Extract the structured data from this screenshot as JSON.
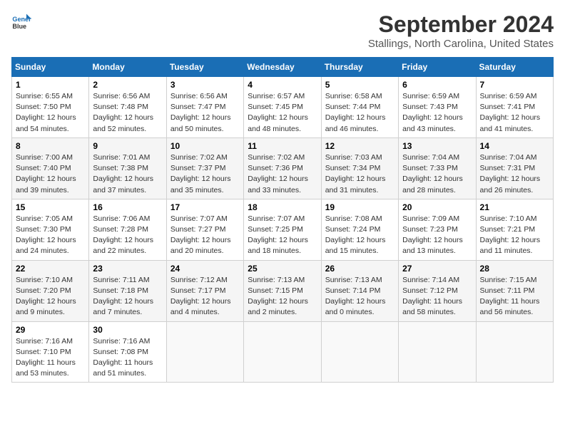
{
  "header": {
    "logo_line1": "General",
    "logo_line2": "Blue",
    "month": "September 2024",
    "location": "Stallings, North Carolina, United States"
  },
  "weekdays": [
    "Sunday",
    "Monday",
    "Tuesday",
    "Wednesday",
    "Thursday",
    "Friday",
    "Saturday"
  ],
  "weeks": [
    [
      {
        "day": "1",
        "sunrise": "6:55 AM",
        "sunset": "7:50 PM",
        "daylight": "12 hours and 54 minutes."
      },
      {
        "day": "2",
        "sunrise": "6:56 AM",
        "sunset": "7:48 PM",
        "daylight": "12 hours and 52 minutes."
      },
      {
        "day": "3",
        "sunrise": "6:56 AM",
        "sunset": "7:47 PM",
        "daylight": "12 hours and 50 minutes."
      },
      {
        "day": "4",
        "sunrise": "6:57 AM",
        "sunset": "7:45 PM",
        "daylight": "12 hours and 48 minutes."
      },
      {
        "day": "5",
        "sunrise": "6:58 AM",
        "sunset": "7:44 PM",
        "daylight": "12 hours and 46 minutes."
      },
      {
        "day": "6",
        "sunrise": "6:59 AM",
        "sunset": "7:43 PM",
        "daylight": "12 hours and 43 minutes."
      },
      {
        "day": "7",
        "sunrise": "6:59 AM",
        "sunset": "7:41 PM",
        "daylight": "12 hours and 41 minutes."
      }
    ],
    [
      {
        "day": "8",
        "sunrise": "7:00 AM",
        "sunset": "7:40 PM",
        "daylight": "12 hours and 39 minutes."
      },
      {
        "day": "9",
        "sunrise": "7:01 AM",
        "sunset": "7:38 PM",
        "daylight": "12 hours and 37 minutes."
      },
      {
        "day": "10",
        "sunrise": "7:02 AM",
        "sunset": "7:37 PM",
        "daylight": "12 hours and 35 minutes."
      },
      {
        "day": "11",
        "sunrise": "7:02 AM",
        "sunset": "7:36 PM",
        "daylight": "12 hours and 33 minutes."
      },
      {
        "day": "12",
        "sunrise": "7:03 AM",
        "sunset": "7:34 PM",
        "daylight": "12 hours and 31 minutes."
      },
      {
        "day": "13",
        "sunrise": "7:04 AM",
        "sunset": "7:33 PM",
        "daylight": "12 hours and 28 minutes."
      },
      {
        "day": "14",
        "sunrise": "7:04 AM",
        "sunset": "7:31 PM",
        "daylight": "12 hours and 26 minutes."
      }
    ],
    [
      {
        "day": "15",
        "sunrise": "7:05 AM",
        "sunset": "7:30 PM",
        "daylight": "12 hours and 24 minutes."
      },
      {
        "day": "16",
        "sunrise": "7:06 AM",
        "sunset": "7:28 PM",
        "daylight": "12 hours and 22 minutes."
      },
      {
        "day": "17",
        "sunrise": "7:07 AM",
        "sunset": "7:27 PM",
        "daylight": "12 hours and 20 minutes."
      },
      {
        "day": "18",
        "sunrise": "7:07 AM",
        "sunset": "7:25 PM",
        "daylight": "12 hours and 18 minutes."
      },
      {
        "day": "19",
        "sunrise": "7:08 AM",
        "sunset": "7:24 PM",
        "daylight": "12 hours and 15 minutes."
      },
      {
        "day": "20",
        "sunrise": "7:09 AM",
        "sunset": "7:23 PM",
        "daylight": "12 hours and 13 minutes."
      },
      {
        "day": "21",
        "sunrise": "7:10 AM",
        "sunset": "7:21 PM",
        "daylight": "12 hours and 11 minutes."
      }
    ],
    [
      {
        "day": "22",
        "sunrise": "7:10 AM",
        "sunset": "7:20 PM",
        "daylight": "12 hours and 9 minutes."
      },
      {
        "day": "23",
        "sunrise": "7:11 AM",
        "sunset": "7:18 PM",
        "daylight": "12 hours and 7 minutes."
      },
      {
        "day": "24",
        "sunrise": "7:12 AM",
        "sunset": "7:17 PM",
        "daylight": "12 hours and 4 minutes."
      },
      {
        "day": "25",
        "sunrise": "7:13 AM",
        "sunset": "7:15 PM",
        "daylight": "12 hours and 2 minutes."
      },
      {
        "day": "26",
        "sunrise": "7:13 AM",
        "sunset": "7:14 PM",
        "daylight": "12 hours and 0 minutes."
      },
      {
        "day": "27",
        "sunrise": "7:14 AM",
        "sunset": "7:12 PM",
        "daylight": "11 hours and 58 minutes."
      },
      {
        "day": "28",
        "sunrise": "7:15 AM",
        "sunset": "7:11 PM",
        "daylight": "11 hours and 56 minutes."
      }
    ],
    [
      {
        "day": "29",
        "sunrise": "7:16 AM",
        "sunset": "7:10 PM",
        "daylight": "11 hours and 53 minutes."
      },
      {
        "day": "30",
        "sunrise": "7:16 AM",
        "sunset": "7:08 PM",
        "daylight": "11 hours and 51 minutes."
      },
      null,
      null,
      null,
      null,
      null
    ]
  ]
}
